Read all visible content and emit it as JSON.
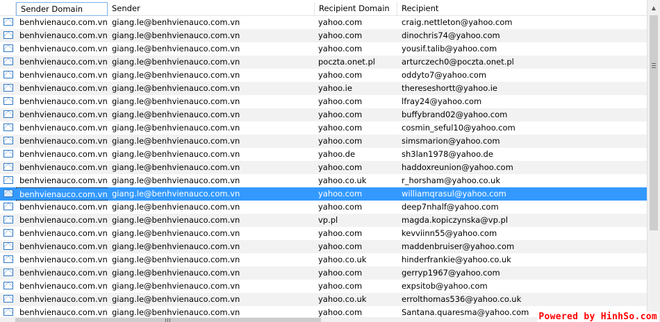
{
  "columns": {
    "sender_domain": "Sender Domain",
    "sender": "Sender",
    "recipient_domain": "Recipient Domain",
    "recipient": "Recipient"
  },
  "row_icon": "envelope-icon",
  "selected_row": 13,
  "colors": {
    "selection": "#3399ff",
    "icon": "#2f78c4",
    "watermark": "#ff0000"
  },
  "rows": [
    {
      "sender_domain": "benhvienauco.com.vn",
      "sender": "giang.le@benhvienauco.com.vn",
      "recipient_domain": "yahoo.com",
      "recipient": "craig.nettleton@yahoo.com"
    },
    {
      "sender_domain": "benhvienauco.com.vn",
      "sender": "giang.le@benhvienauco.com.vn",
      "recipient_domain": "yahoo.com",
      "recipient": "dinochris74@yahoo.com"
    },
    {
      "sender_domain": "benhvienauco.com.vn",
      "sender": "giang.le@benhvienauco.com.vn",
      "recipient_domain": "yahoo.com",
      "recipient": "yousif.talib@yahoo.com"
    },
    {
      "sender_domain": "benhvienauco.com.vn",
      "sender": "giang.le@benhvienauco.com.vn",
      "recipient_domain": "poczta.onet.pl",
      "recipient": "arturczech0@poczta.onet.pl"
    },
    {
      "sender_domain": "benhvienauco.com.vn",
      "sender": "giang.le@benhvienauco.com.vn",
      "recipient_domain": "yahoo.com",
      "recipient": "oddyto7@yahoo.com"
    },
    {
      "sender_domain": "benhvienauco.com.vn",
      "sender": "giang.le@benhvienauco.com.vn",
      "recipient_domain": "yahoo.ie",
      "recipient": "thereseshortt@yahoo.ie"
    },
    {
      "sender_domain": "benhvienauco.com.vn",
      "sender": "giang.le@benhvienauco.com.vn",
      "recipient_domain": "yahoo.com",
      "recipient": "lfray24@yahoo.com"
    },
    {
      "sender_domain": "benhvienauco.com.vn",
      "sender": "giang.le@benhvienauco.com.vn",
      "recipient_domain": "yahoo.com",
      "recipient": "buffybrand02@yahoo.com"
    },
    {
      "sender_domain": "benhvienauco.com.vn",
      "sender": "giang.le@benhvienauco.com.vn",
      "recipient_domain": "yahoo.com",
      "recipient": "cosmin_seful10@yahoo.com"
    },
    {
      "sender_domain": "benhvienauco.com.vn",
      "sender": "giang.le@benhvienauco.com.vn",
      "recipient_domain": "yahoo.com",
      "recipient": "simsmarion@yahoo.com"
    },
    {
      "sender_domain": "benhvienauco.com.vn",
      "sender": "giang.le@benhvienauco.com.vn",
      "recipient_domain": "yahoo.de",
      "recipient": "sh3lan1978@yahoo.de"
    },
    {
      "sender_domain": "benhvienauco.com.vn",
      "sender": "giang.le@benhvienauco.com.vn",
      "recipient_domain": "yahoo.com",
      "recipient": "haddoxreunion@yahoo.com"
    },
    {
      "sender_domain": "benhvienauco.com.vn",
      "sender": "giang.le@benhvienauco.com.vn",
      "recipient_domain": "yahoo.co.uk",
      "recipient": "r_horsham@yahoo.co.uk"
    },
    {
      "sender_domain": "benhvienauco.com.vn",
      "sender": "giang.le@benhvienauco.com.vn",
      "recipient_domain": "yahoo.com",
      "recipient": "williamqrasul@yahoo.com"
    },
    {
      "sender_domain": "benhvienauco.com.vn",
      "sender": "giang.le@benhvienauco.com.vn",
      "recipient_domain": "yahoo.com",
      "recipient": "deep7nhalf@yahoo.com"
    },
    {
      "sender_domain": "benhvienauco.com.vn",
      "sender": "giang.le@benhvienauco.com.vn",
      "recipient_domain": "vp.pl",
      "recipient": "magda.kopiczynska@vp.pl"
    },
    {
      "sender_domain": "benhvienauco.com.vn",
      "sender": "giang.le@benhvienauco.com.vn",
      "recipient_domain": "yahoo.com",
      "recipient": "kevviinn55@yahoo.com"
    },
    {
      "sender_domain": "benhvienauco.com.vn",
      "sender": "giang.le@benhvienauco.com.vn",
      "recipient_domain": "yahoo.com",
      "recipient": "maddenbruiser@yahoo.com"
    },
    {
      "sender_domain": "benhvienauco.com.vn",
      "sender": "giang.le@benhvienauco.com.vn",
      "recipient_domain": "yahoo.co.uk",
      "recipient": "hinderfrankie@yahoo.co.uk"
    },
    {
      "sender_domain": "benhvienauco.com.vn",
      "sender": "giang.le@benhvienauco.com.vn",
      "recipient_domain": "yahoo.com",
      "recipient": "gerryp1967@yahoo.com"
    },
    {
      "sender_domain": "benhvienauco.com.vn",
      "sender": "giang.le@benhvienauco.com.vn",
      "recipient_domain": "yahoo.com",
      "recipient": "expsitob@yahoo.com"
    },
    {
      "sender_domain": "benhvienauco.com.vn",
      "sender": "giang.le@benhvienauco.com.vn",
      "recipient_domain": "yahoo.co.uk",
      "recipient": "errolthomas536@yahoo.co.uk"
    },
    {
      "sender_domain": "benhvienauco.com.vn",
      "sender": "giang.le@benhvienauco.com.vn",
      "recipient_domain": "yahoo.com",
      "recipient": "Santana.quaresma@yahoo.com"
    }
  ],
  "watermark": "Powered by HinhSo.com"
}
